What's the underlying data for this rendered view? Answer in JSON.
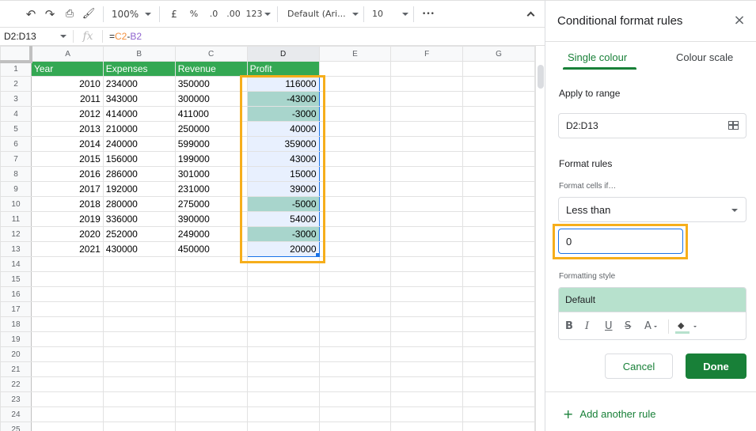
{
  "toolbar": {
    "zoom": "100%",
    "currency": "£",
    "percent": "%",
    "decrease_decimals": ".0",
    "increase_decimals": ".00",
    "more_formats": "123",
    "font": "Default (Ari...",
    "font_size": "10",
    "more": "•••",
    "collapse": "^"
  },
  "formula_bar": {
    "name_box": "D2:D13",
    "fx": "fx",
    "formula_eq": "=",
    "formula_ref1": "C2",
    "formula_op": "-",
    "formula_ref2": "B2"
  },
  "grid": {
    "columns": [
      "A",
      "B",
      "C",
      "D",
      "E",
      "F",
      "G"
    ],
    "selected_column": "D",
    "header_row": [
      "Year",
      "Expenses",
      "Revenue",
      "Profit"
    ],
    "rows": [
      {
        "n": "2",
        "year": "2010",
        "expenses": "234000",
        "revenue": "350000",
        "profit": "116000",
        "neg": false
      },
      {
        "n": "3",
        "year": "2011",
        "expenses": "343000",
        "revenue": "300000",
        "profit": "-43000",
        "neg": true
      },
      {
        "n": "4",
        "year": "2012",
        "expenses": "414000",
        "revenue": "411000",
        "profit": "-3000",
        "neg": true
      },
      {
        "n": "5",
        "year": "2013",
        "expenses": "210000",
        "revenue": "250000",
        "profit": "40000",
        "neg": false
      },
      {
        "n": "6",
        "year": "2014",
        "expenses": "240000",
        "revenue": "599000",
        "profit": "359000",
        "neg": false
      },
      {
        "n": "7",
        "year": "2015",
        "expenses": "156000",
        "revenue": "199000",
        "profit": "43000",
        "neg": false
      },
      {
        "n": "8",
        "year": "2016",
        "expenses": "286000",
        "revenue": "301000",
        "profit": "15000",
        "neg": false
      },
      {
        "n": "9",
        "year": "2017",
        "expenses": "192000",
        "revenue": "231000",
        "profit": "39000",
        "neg": false
      },
      {
        "n": "10",
        "year": "2018",
        "expenses": "280000",
        "revenue": "275000",
        "profit": "-5000",
        "neg": true
      },
      {
        "n": "11",
        "year": "2019",
        "expenses": "336000",
        "revenue": "390000",
        "profit": "54000",
        "neg": false
      },
      {
        "n": "12",
        "year": "2020",
        "expenses": "252000",
        "revenue": "249000",
        "profit": "-3000",
        "neg": true
      },
      {
        "n": "13",
        "year": "2021",
        "expenses": "430000",
        "revenue": "450000",
        "profit": "20000",
        "neg": false
      }
    ],
    "empty_rows": [
      "14",
      "15",
      "16",
      "17",
      "18",
      "19",
      "20",
      "21",
      "22",
      "23",
      "24",
      "25"
    ]
  },
  "panel": {
    "title": "Conditional format rules",
    "close": "×",
    "tabs": [
      {
        "label": "Single colour",
        "active": true
      },
      {
        "label": "Colour scale",
        "active": false
      }
    ],
    "apply_to_range_label": "Apply to range",
    "range_value": "D2:D13",
    "format_rules_label": "Format rules",
    "format_cells_if_label": "Format cells if…",
    "condition": "Less than",
    "condition_value": "0",
    "formatting_style_label": "Formatting style",
    "style_preview": "Default",
    "style_tools": {
      "bold": "B",
      "italic": "I",
      "underline": "U",
      "strikethrough": "S",
      "text_color": "A",
      "fill": "◆"
    },
    "cancel_label": "Cancel",
    "done_label": "Done",
    "add_rule_label": "Add another rule",
    "add_rule_icon": "+"
  },
  "colors": {
    "accent_green": "#188038",
    "header_green": "#34a853",
    "highlight_fill": "#a8d5cc",
    "style_preview": "#b7e1cd",
    "selection_blue": "#1a73e8",
    "annotation_orange": "#f6ae1b"
  }
}
